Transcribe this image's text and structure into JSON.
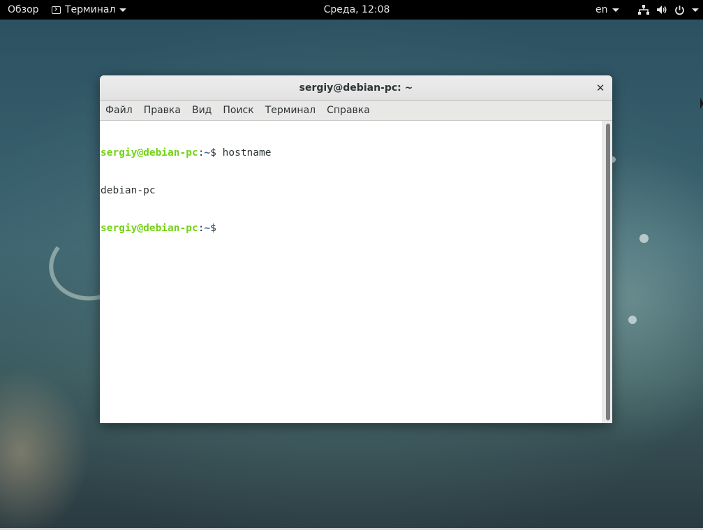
{
  "topbar": {
    "activities_label": "Обзор",
    "app_menu_label": "Терминал",
    "clock": "Среда, 12:08",
    "keyboard_layout": "en",
    "tray_icons": [
      "network-icon",
      "volume-icon",
      "power-icon"
    ]
  },
  "window": {
    "title": "sergiy@debian-pc: ~",
    "close_glyph": "✕",
    "menu": [
      "Файл",
      "Правка",
      "Вид",
      "Поиск",
      "Терминал",
      "Справка"
    ]
  },
  "terminal": {
    "lines": [
      {
        "user_host": "sergiy@debian-pc",
        "sep": ":",
        "path": "~",
        "dollar": "$ ",
        "command": "hostname"
      },
      {
        "output": "debian-pc"
      },
      {
        "user_host": "sergiy@debian-pc",
        "sep": ":",
        "path": "~",
        "dollar": "$",
        "command": ""
      }
    ],
    "colors": {
      "prompt_user": "#73d216",
      "prompt_path": "#3465a4",
      "text": "#2e3436"
    }
  }
}
